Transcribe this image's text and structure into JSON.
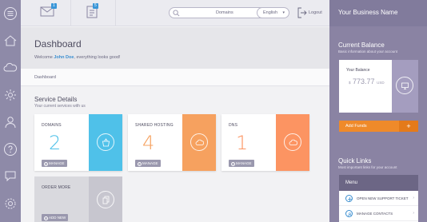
{
  "header": {
    "messages_badge": "1",
    "tasks_badge": "5",
    "search": {
      "selected": "Domains",
      "caret": "▾"
    },
    "language": {
      "selected": "English",
      "caret": "▾"
    },
    "logout_label": "Logout"
  },
  "main": {
    "title": "Dashboard",
    "welcome_prefix": "Welcome ",
    "welcome_name": "John Doe",
    "welcome_suffix": ", everything looks good!",
    "breadcrumb": "Dashboard",
    "services": {
      "title": "Service Details",
      "subtitle": "Your current services with us",
      "cards": [
        {
          "label": "Domains",
          "count": "2",
          "button": "MANAGE",
          "accent": "#4fc1e9",
          "num_color": "#4fc1e9",
          "icon": "basket-icon"
        },
        {
          "label": "Shared Hosting",
          "count": "4",
          "button": "MANAGE",
          "accent": "#f6a15f",
          "num_color": "#f6a15f",
          "icon": "cloud-icon"
        },
        {
          "label": "DNS",
          "count": "1",
          "button": "MANAGE",
          "accent": "#fc9462",
          "num_color": "#fc9462",
          "icon": "cloud-icon"
        },
        {
          "label": "Order More",
          "count": "",
          "button": "ADD NEW",
          "accent": "#c7c6cf",
          "num_color": "#c7c6cf",
          "icon": "documents-icon"
        }
      ]
    }
  },
  "sidebar_right": {
    "brand": "Your Business Name",
    "balance": {
      "title": "Current Balance",
      "subtitle": "Basic information about your account",
      "label": "Your Balance",
      "currency_symbol": "$",
      "amount": "773.77",
      "currency_code": "USD",
      "add_funds": "Add Funds",
      "add_plus": "+"
    },
    "quick_links": {
      "title": "Quick Links",
      "subtitle": "Most important links for your account",
      "menu_title": "Menu",
      "items": [
        {
          "label": "OPEN NEW SUPPORT TICKET",
          "icon": "plus-icon",
          "chevron": "›"
        },
        {
          "label": "MANAGE CONTACTS",
          "icon": "contacts-icon",
          "chevron": "›"
        }
      ]
    }
  },
  "colors": {
    "rail": "#8e8aa8",
    "accent_blue": "#3a8ed0",
    "orange": "#ef8a2a",
    "panel": "#8a83a3"
  }
}
